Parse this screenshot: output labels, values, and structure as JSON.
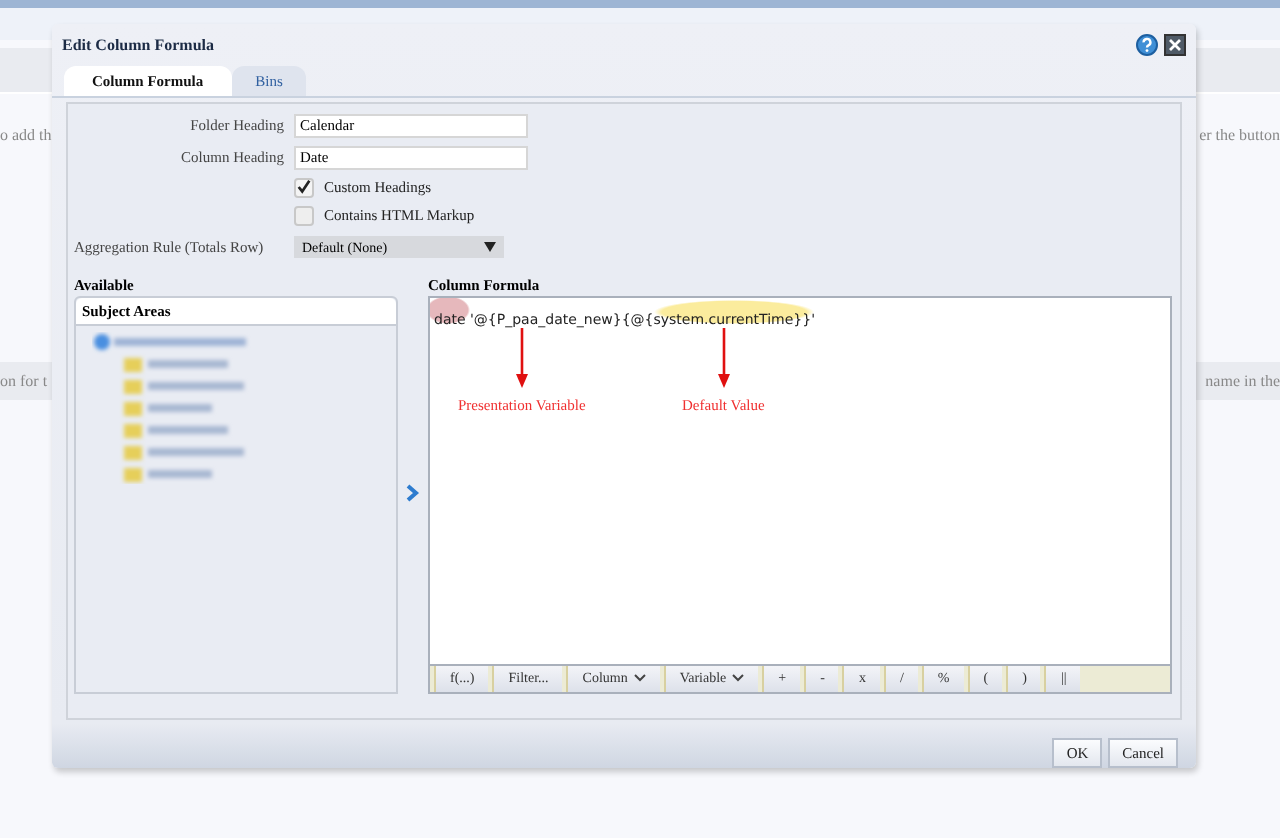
{
  "page_text": {
    "top_left": "o add th",
    "top_right": "er the button",
    "band_left": "on for t",
    "band_right": "name in the"
  },
  "dialog": {
    "title": "Edit Column Formula",
    "tabs": [
      {
        "label": "Column Formula",
        "selected": true
      },
      {
        "label": "Bins",
        "selected": false
      }
    ],
    "folder_heading": {
      "label": "Folder Heading",
      "value": "Calendar"
    },
    "column_heading": {
      "label": "Column Heading",
      "value": "Date"
    },
    "options": [
      {
        "label": "Custom Headings",
        "checked": true
      },
      {
        "label": "Contains HTML Markup",
        "checked": false
      }
    ],
    "aggregation": {
      "label": "Aggregation Rule (Totals Row)",
      "value": "Default (None)"
    },
    "available": {
      "label": "Available",
      "panel_title": "Subject Areas"
    },
    "formula": {
      "label": "Column Formula",
      "text": "date '@{P_paa_date_new}{@{system.currentTime}}'",
      "annotations": [
        {
          "label": "Presentation Variable"
        },
        {
          "label": "Default Value"
        }
      ],
      "toolbar": [
        {
          "label": "f(...)",
          "kind": "plain"
        },
        {
          "label": "Filter...",
          "kind": "plain"
        },
        {
          "label": "Column",
          "kind": "menu"
        },
        {
          "label": "Variable",
          "kind": "menu"
        },
        {
          "label": "+",
          "kind": "plain"
        },
        {
          "label": "-",
          "kind": "plain"
        },
        {
          "label": "x",
          "kind": "plain"
        },
        {
          "label": "/",
          "kind": "plain"
        },
        {
          "label": "%",
          "kind": "plain"
        },
        {
          "label": "(",
          "kind": "plain"
        },
        {
          "label": ")",
          "kind": "plain"
        },
        {
          "label": "||",
          "kind": "plain"
        }
      ]
    },
    "buttons": [
      "OK",
      "Cancel"
    ]
  }
}
